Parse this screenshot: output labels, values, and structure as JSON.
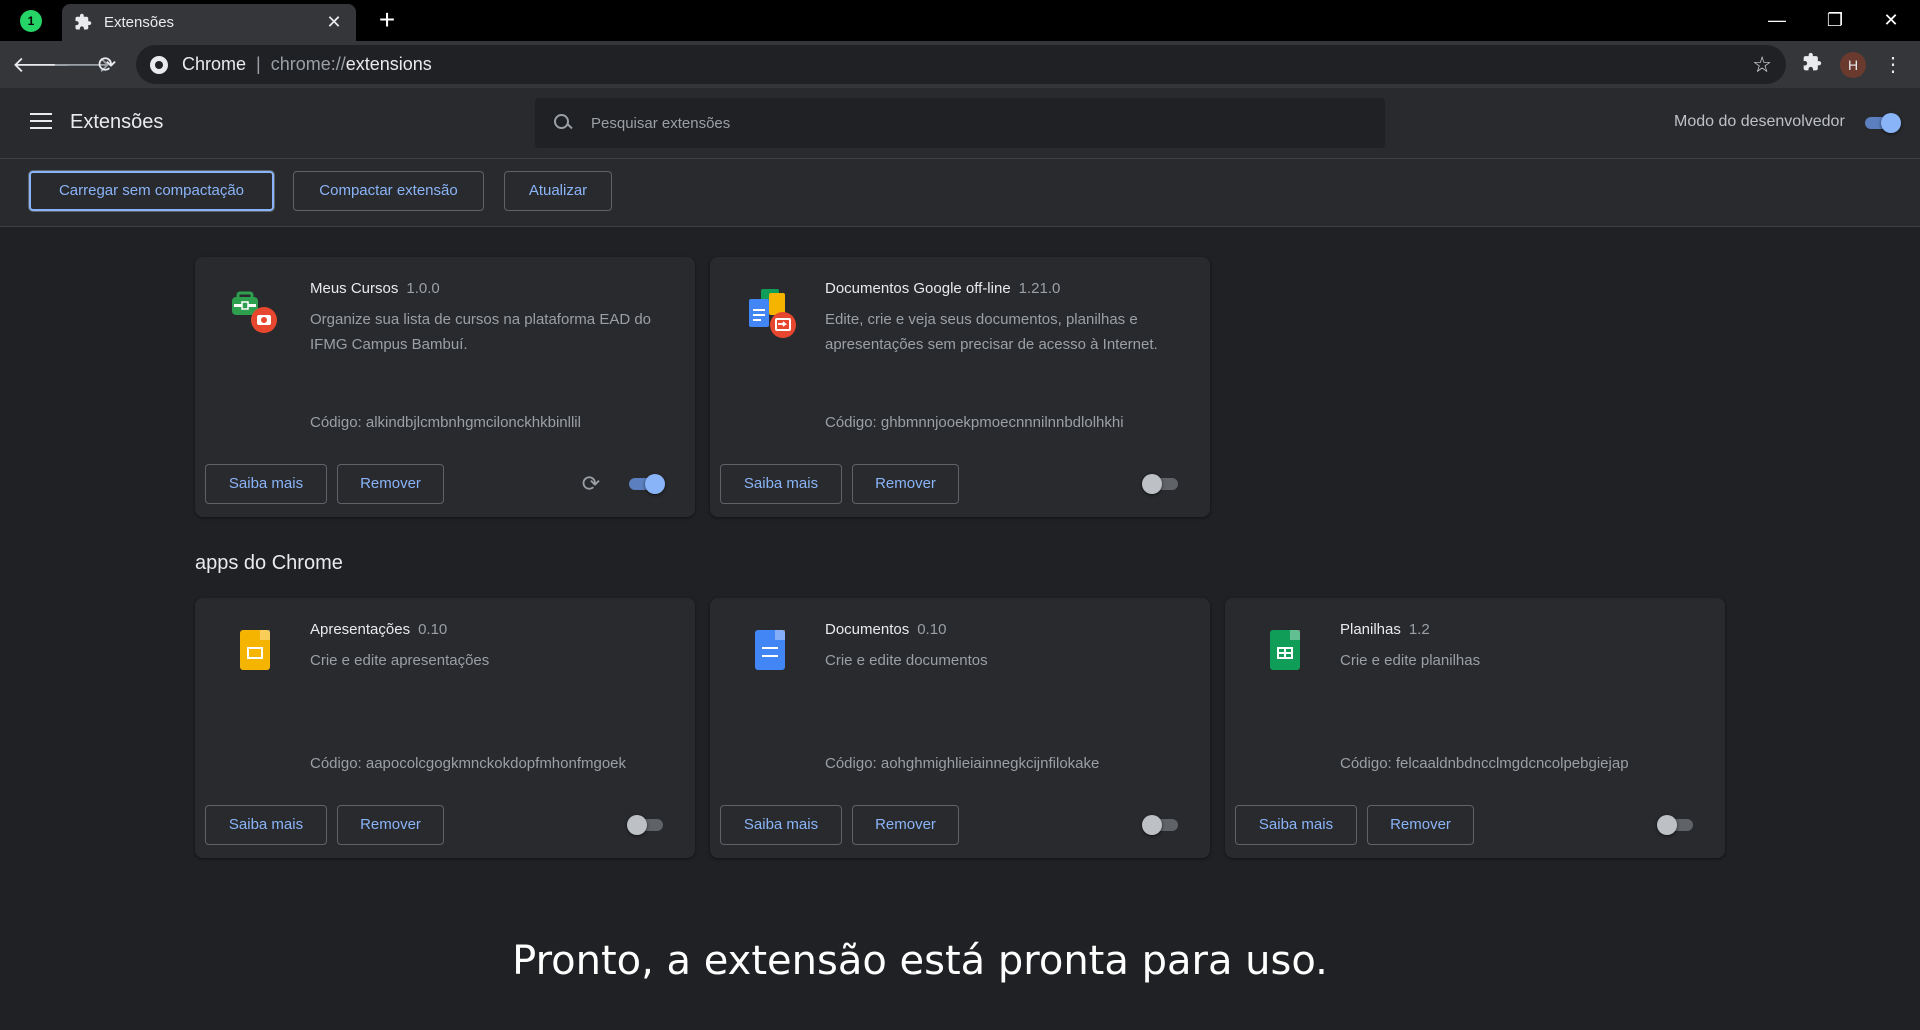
{
  "browser": {
    "tab_title": "Extensões",
    "omnibox_chip": "Chrome",
    "url_scheme": "chrome://",
    "url_path": "extensions",
    "profile_initial": "H"
  },
  "header": {
    "title": "Extensões",
    "search_placeholder": "Pesquisar extensões",
    "dev_mode_label": "Modo do desenvolvedor",
    "dev_mode_on": true
  },
  "actions": {
    "load_unpacked": "Carregar sem compactação",
    "pack": "Compactar extensão",
    "update": "Atualizar"
  },
  "extensions": [
    {
      "name": "Meus Cursos",
      "version": "1.0.0",
      "description": "Organize sua lista de cursos na plataforma EAD do IFMG Campus Bambuí.",
      "code": "Código: alkindbjlcmbnhgmcilonckhkbinllil",
      "details": "Saiba mais",
      "remove": "Remover",
      "enabled": true
    },
    {
      "name": "Documentos Google off-line",
      "version": "1.21.0",
      "description": "Edite, crie e veja seus documentos, planilhas e apresentações sem precisar de acesso à Internet.",
      "code": "Código: ghbmnnjooekpmoecnnnilnnbdlolhkhi",
      "details": "Saiba mais",
      "remove": "Remover",
      "enabled": false
    }
  ],
  "apps_section_title": "apps do Chrome",
  "apps": [
    {
      "name": "Apresentações",
      "version": "0.10",
      "description": "Crie e edite apresentações",
      "code": "Código: aapocolcgogkmnckokdopfmhonfmgoek",
      "details": "Saiba mais",
      "remove": "Remover",
      "enabled": false,
      "color": "#f4b400"
    },
    {
      "name": "Documentos",
      "version": "0.10",
      "description": "Crie e edite documentos",
      "code": "Código: aohghmighlieiainnegkcijnfilokake",
      "details": "Saiba mais",
      "remove": "Remover",
      "enabled": false,
      "color": "#4285f4"
    },
    {
      "name": "Planilhas",
      "version": "1.2",
      "description": "Crie e edite planilhas",
      "code": "Código: felcaaldnbdncclmgdcncolpebgiejap",
      "details": "Saiba mais",
      "remove": "Remover",
      "enabled": false,
      "color": "#0f9d58"
    }
  ],
  "caption": "Pronto, a extensão está pronta para uso."
}
